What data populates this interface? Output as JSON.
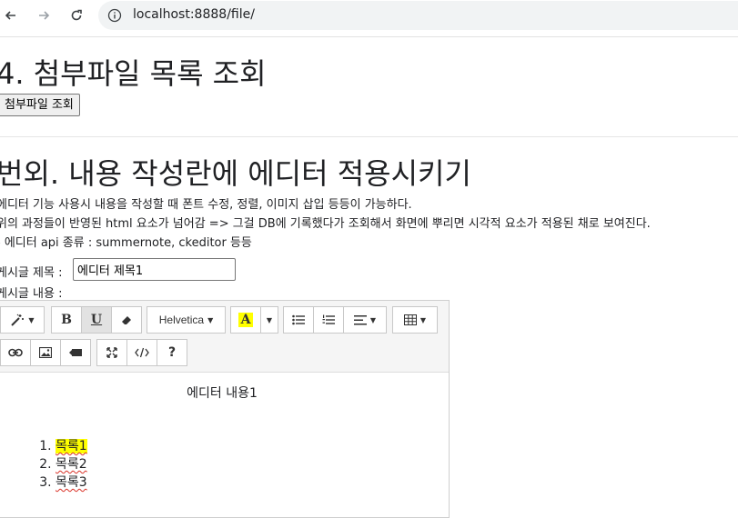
{
  "browser": {
    "url": "localhost:8888/file/"
  },
  "section4": {
    "heading": "4. 첨부파일 목록 조회",
    "button_label": "첨부파일 조회"
  },
  "bonus": {
    "heading": "번외. 내용 작성란에 에디터 적용시키기",
    "paragraphs": [
      "에디터 기능 사용시 내용을 작성할 때 폰트 수정, 정렬, 이미지 삽입 등등이 가능하다.",
      "위의 과정들이 반영된 html 요소가 넘어감 => 그걸 DB에 기록했다가 조회해서 화면에 뿌리면 시각적 요소가 적용된 채로 보여진다.",
      "- 에디터 api 종류 : summernote, ckeditor 등등"
    ],
    "title_label": "게시글 제목 :",
    "title_value": "에디터 제목1",
    "content_label": "게시글 내용 :"
  },
  "editor": {
    "toolbar": {
      "font_name": "Helvetica",
      "bold": "B",
      "underline": "U",
      "help": "?",
      "highlight_color": "#ffff00"
    },
    "content": {
      "centered_text": "에디터 내용1",
      "list_items": [
        "목록1",
        "목록2",
        "목록3"
      ]
    }
  }
}
